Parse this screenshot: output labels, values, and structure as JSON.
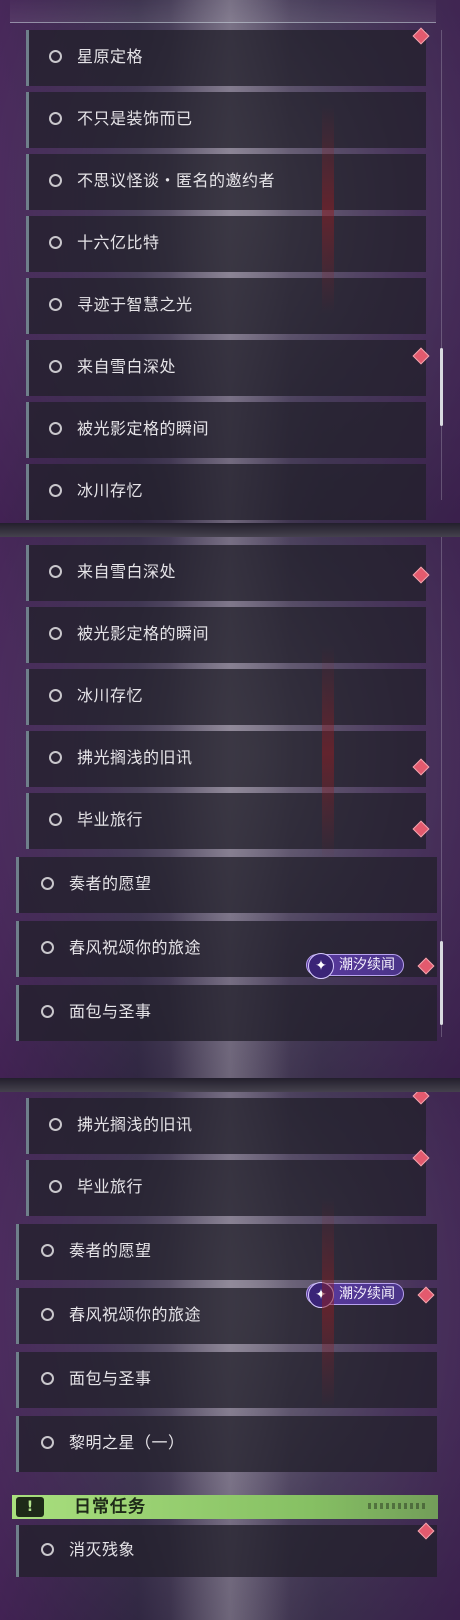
{
  "accent_colors": {
    "marker": "#e35a6e",
    "tag_bg": "#5a3aa0",
    "daily_header": "#a9df7e",
    "item_bg": "#22202c"
  },
  "segments": [
    {
      "items": [
        {
          "label": "星原定格"
        },
        {
          "label": "不只是装饰而已"
        },
        {
          "label": "不思议怪谈・匿名的邀约者"
        },
        {
          "label": "十六亿比特"
        },
        {
          "label": "寻迹于智慧之光"
        },
        {
          "label": "来自雪白深处"
        },
        {
          "label": "被光影定格的瞬间"
        },
        {
          "label": "冰川存忆"
        }
      ]
    },
    {
      "items": [
        {
          "label": "来自雪白深处"
        },
        {
          "label": "被光影定格的瞬间"
        },
        {
          "label": "冰川存忆"
        },
        {
          "label": "拂光搁浅的旧讯"
        },
        {
          "label": "毕业旅行"
        },
        {
          "label": "奏者的愿望"
        },
        {
          "label": "春风祝颂你的旅途"
        },
        {
          "label": "面包与圣事"
        }
      ],
      "tag": {
        "text": "潮汐续闻",
        "icon": "sparkle-icon"
      }
    },
    {
      "items": [
        {
          "label": "拂光搁浅的旧讯"
        },
        {
          "label": "毕业旅行"
        },
        {
          "label": "奏者的愿望"
        },
        {
          "label": "春风祝颂你的旅途"
        },
        {
          "label": "面包与圣事"
        },
        {
          "label": "黎明之星（一）"
        }
      ],
      "tag": {
        "text": "潮汐续闻",
        "icon": "sparkle-icon"
      },
      "section": {
        "title": "日常任务",
        "icon_glyph": "!"
      },
      "section_items": [
        {
          "label": "消灭残象"
        }
      ]
    }
  ]
}
